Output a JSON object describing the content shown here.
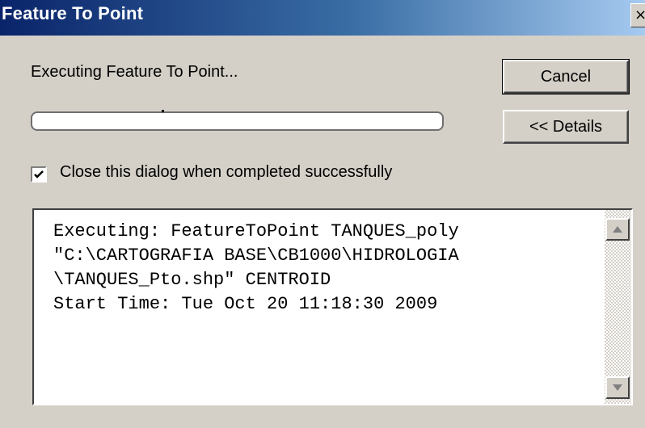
{
  "window": {
    "title": "Feature To Point",
    "close_glyph": "×"
  },
  "status": {
    "message": "Executing Feature To Point...",
    "progress_fraction": 0.0
  },
  "buttons": {
    "cancel_label": "Cancel",
    "details_label": "<< Details"
  },
  "options": {
    "close_on_complete_label": "Close this dialog when completed successfully",
    "close_on_complete_checked": true
  },
  "log": {
    "lines": [
      "Executing: FeatureToPoint TANQUES_poly",
      "\"C:\\CARTOGRAFIA BASE\\CB1000\\HIDROLOGIA",
      "\\TANQUES_Pto.shp\" CENTROID",
      "Start Time: Tue Oct 20 11:18:30 2009"
    ]
  },
  "icons": {
    "close": "close-icon",
    "check": "checkmark-icon",
    "scroll_up": "scroll-up-arrow-icon",
    "scroll_down": "scroll-down-arrow-icon"
  }
}
